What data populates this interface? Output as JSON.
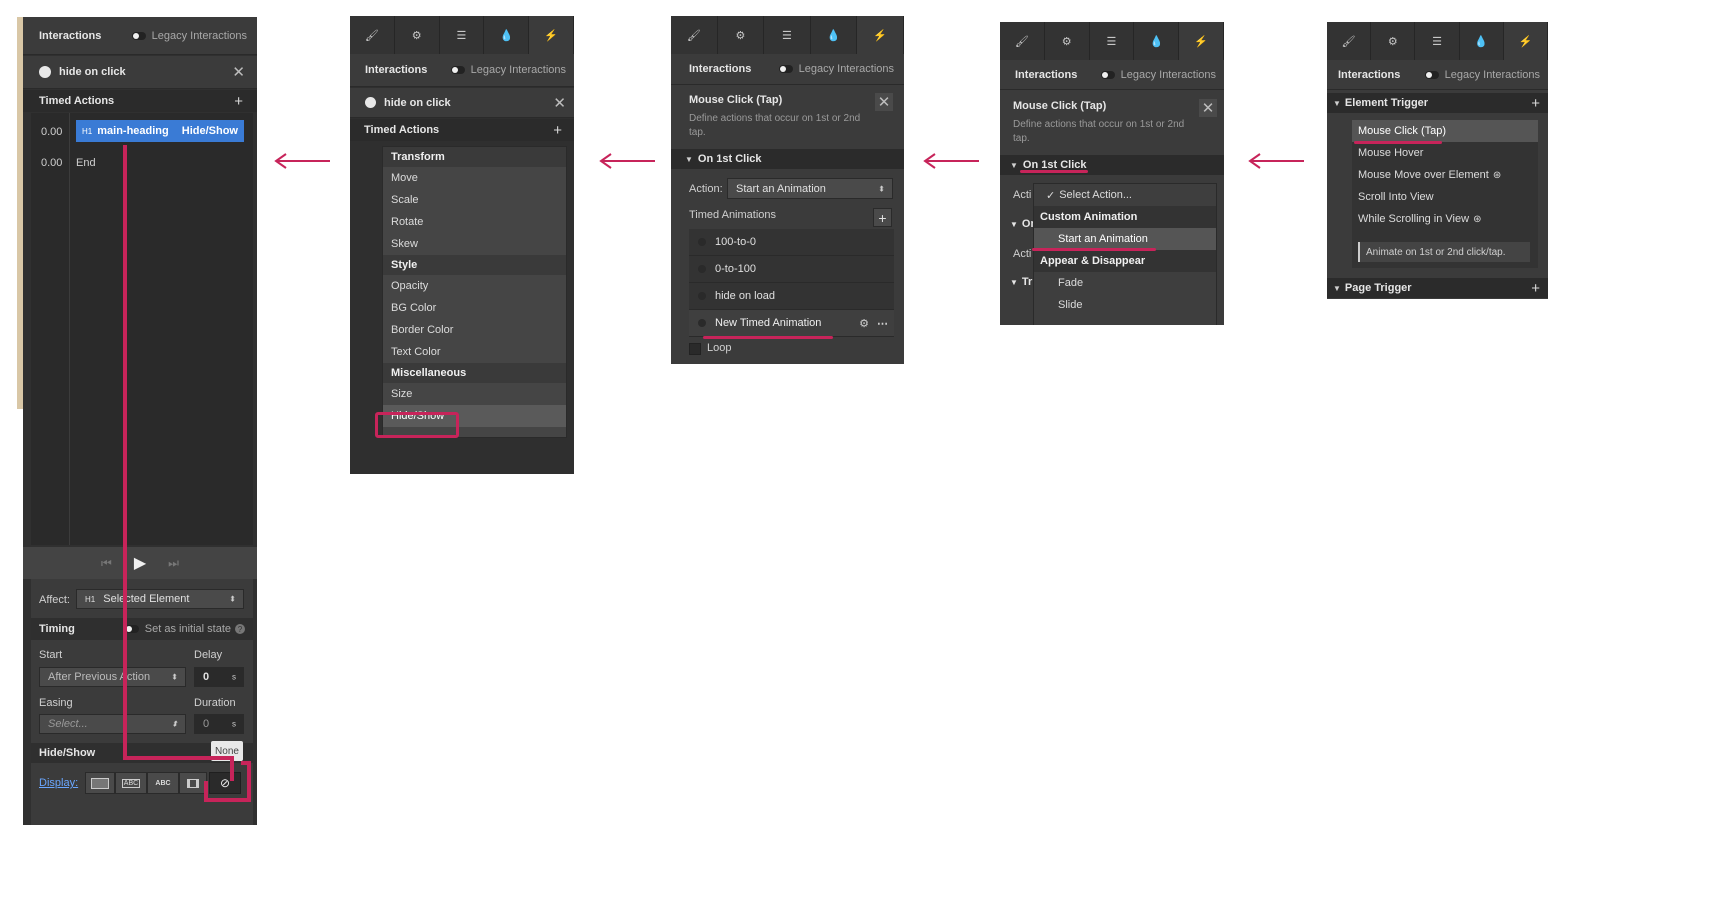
{
  "arrows": {
    "color": "#c7245a"
  },
  "header": {
    "interactions": "Interactions",
    "legacy": "Legacy Interactions"
  },
  "panel1": {
    "trigger_name": "hide on click",
    "timed_actions": "Timed Actions",
    "timeline": [
      {
        "time": "0.00",
        "tag": "H1",
        "target": "main-heading",
        "action": "Hide/Show"
      },
      {
        "time": "0.00",
        "label": "End"
      }
    ],
    "affect_label": "Affect:",
    "affect_tag": "H1",
    "affect_value": "Selected Element",
    "timing_label": "Timing",
    "initial_state": "Set as initial state",
    "start_label": "Start",
    "start_value": "After Previous Action",
    "delay_label": "Delay",
    "delay_value": "0",
    "delay_unit": "s",
    "easing_label": "Easing",
    "easing_placeholder": "Select...",
    "duration_label": "Duration",
    "duration_value": "0",
    "duration_unit": "s",
    "hideshow_label": "Hide/Show",
    "display_label": "Display:",
    "display_options": [
      "ABC",
      "ABC"
    ],
    "tooltip": "None"
  },
  "panel2": {
    "trigger_name": "hide on click",
    "timed_actions": "Timed Actions",
    "groups": [
      {
        "title": "Transform",
        "items": [
          "Move",
          "Scale",
          "Rotate",
          "Skew"
        ]
      },
      {
        "title": "Style",
        "items": [
          "Opacity",
          "BG Color",
          "Border Color",
          "Text Color"
        ]
      },
      {
        "title": "Miscellaneous",
        "items": [
          "Size",
          "Hide/Show"
        ]
      }
    ]
  },
  "panel3": {
    "trigger_title": "Mouse Click (Tap)",
    "description": "Define actions that occur on 1st or 2nd tap.",
    "section": "On 1st Click",
    "action_label": "Action:",
    "action_value": "Start an Animation",
    "timed_animations": "Timed Animations",
    "animations": [
      "100-to-0",
      "0-to-100",
      "hide on load",
      "New Timed Animation"
    ],
    "loop": "Loop"
  },
  "panel4": {
    "trigger_title": "Mouse Click (Tap)",
    "description": "Define actions that occur on 1st or 2nd tap.",
    "section": "On 1st Click",
    "partial_action": "Acti",
    "partial_on": "On",
    "partial_tri": "Tri",
    "dropdown": {
      "selected": "Select Action...",
      "group1": "Custom Animation",
      "item1": "Start an Animation",
      "group2": "Appear & Disappear",
      "items2": [
        "Fade",
        "Slide"
      ]
    }
  },
  "panel5": {
    "element_trigger": "Element Trigger",
    "triggers": [
      "Mouse Click (Tap)",
      "Mouse Hover",
      "Mouse Move over Element",
      "Scroll Into View",
      "While Scrolling in View"
    ],
    "hint": "Animate on 1st or 2nd click/tap.",
    "page_trigger": "Page Trigger"
  }
}
